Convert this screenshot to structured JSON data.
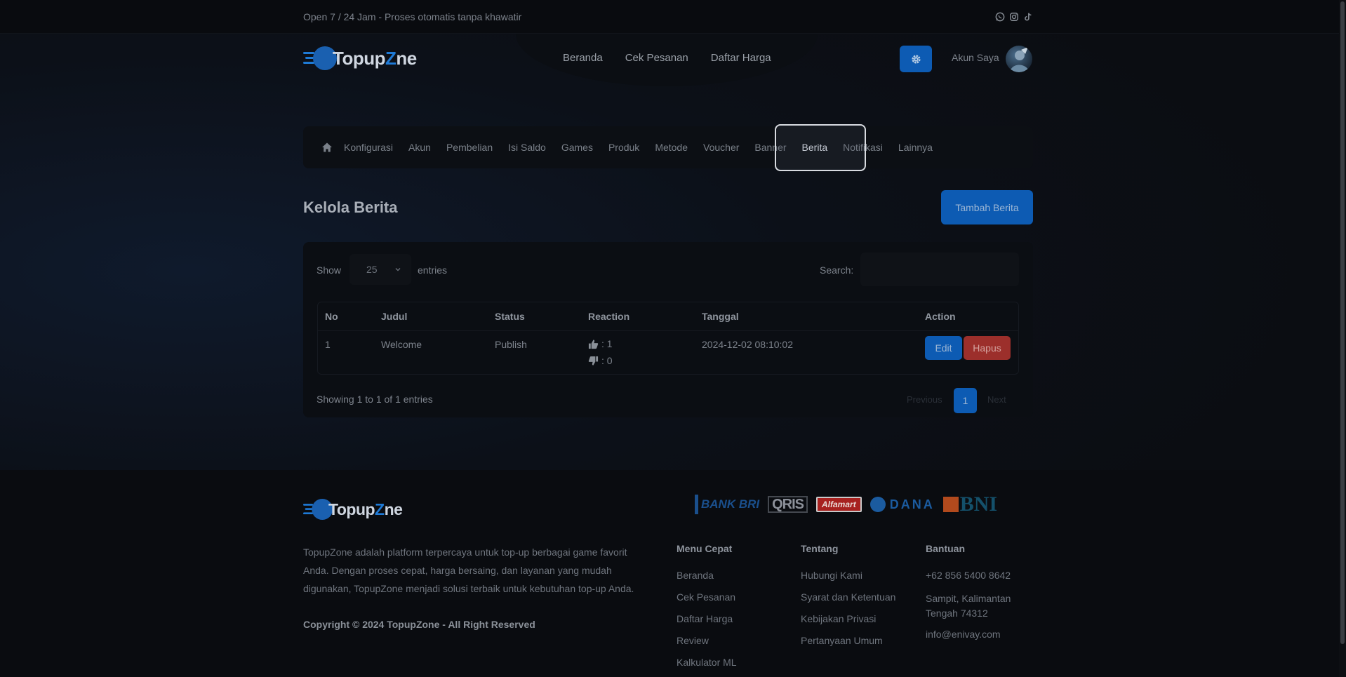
{
  "topbar": {
    "text": "Open 7 / 24 Jam - Proses otomatis tanpa khawatir",
    "socials": [
      "whatsapp-icon",
      "instagram-icon",
      "tiktok-icon"
    ]
  },
  "header": {
    "logo": {
      "part1": "Topup",
      "part2": "Z",
      "part3": "ne"
    },
    "nav": [
      "Beranda",
      "Cek Pesanan",
      "Daftar Harga"
    ],
    "account_label": "Akun Saya"
  },
  "admin_menu": {
    "items": [
      "Konfigurasi",
      "Akun",
      "Pembelian",
      "Isi Saldo",
      "Games",
      "Produk",
      "Metode",
      "Voucher",
      "Banner",
      "Berita",
      "Notifikasi",
      "Lainnya"
    ],
    "active": "Berita"
  },
  "page": {
    "title": "Kelola Berita",
    "add_button": "Tambah Berita"
  },
  "table_controls": {
    "show_label": "Show",
    "entries_value": "25",
    "entries_label": "entries",
    "search_label": "Search:",
    "search_value": ""
  },
  "table": {
    "columns": [
      "No",
      "Judul",
      "Status",
      "Reaction",
      "Tanggal",
      "Action"
    ],
    "rows": [
      {
        "no": "1",
        "judul": "Welcome",
        "status": "Publish",
        "likes": ": 1",
        "dislikes": ": 0",
        "tanggal": "2024-12-02 08:10:02",
        "edit": "Edit",
        "delete": "Hapus"
      }
    ],
    "info": "Showing 1 to 1 of 1 entries",
    "pagination": {
      "prev": "Previous",
      "current": "1",
      "next": "Next"
    }
  },
  "footer": {
    "description": "TopupZone adalah platform terpercaya untuk top-up berbagai game favorit Anda. Dengan proses cepat, harga bersaing, dan layanan yang mudah digunakan, TopupZone menjadi solusi terbaik untuk kebutuhan top-up Anda.",
    "copyright": "Copyright © 2024 TopupZone - All Right Reserved",
    "payments": [
      "BANK BRI",
      "QRIS",
      "Alfamart",
      "DANA",
      "BNI"
    ],
    "menu_cepat": {
      "title": "Menu Cepat",
      "links": [
        "Beranda",
        "Cek Pesanan",
        "Daftar Harga",
        "Review",
        "Kalkulator ML"
      ]
    },
    "tentang": {
      "title": "Tentang",
      "links": [
        "Hubungi Kami",
        "Syarat dan Ketentuan",
        "Kebijakan Privasi",
        "Pertanyaan Umum"
      ]
    },
    "bantuan": {
      "title": "Bantuan",
      "phone": "+62 856 5400 8642",
      "address": "Sampit, Kalimantan Tengah 74312",
      "email": "info@enivay.com"
    }
  },
  "colors": {
    "accent": "#0d5bb3",
    "danger": "#9c2f2b",
    "brand_blue": "#1e7ad6"
  }
}
